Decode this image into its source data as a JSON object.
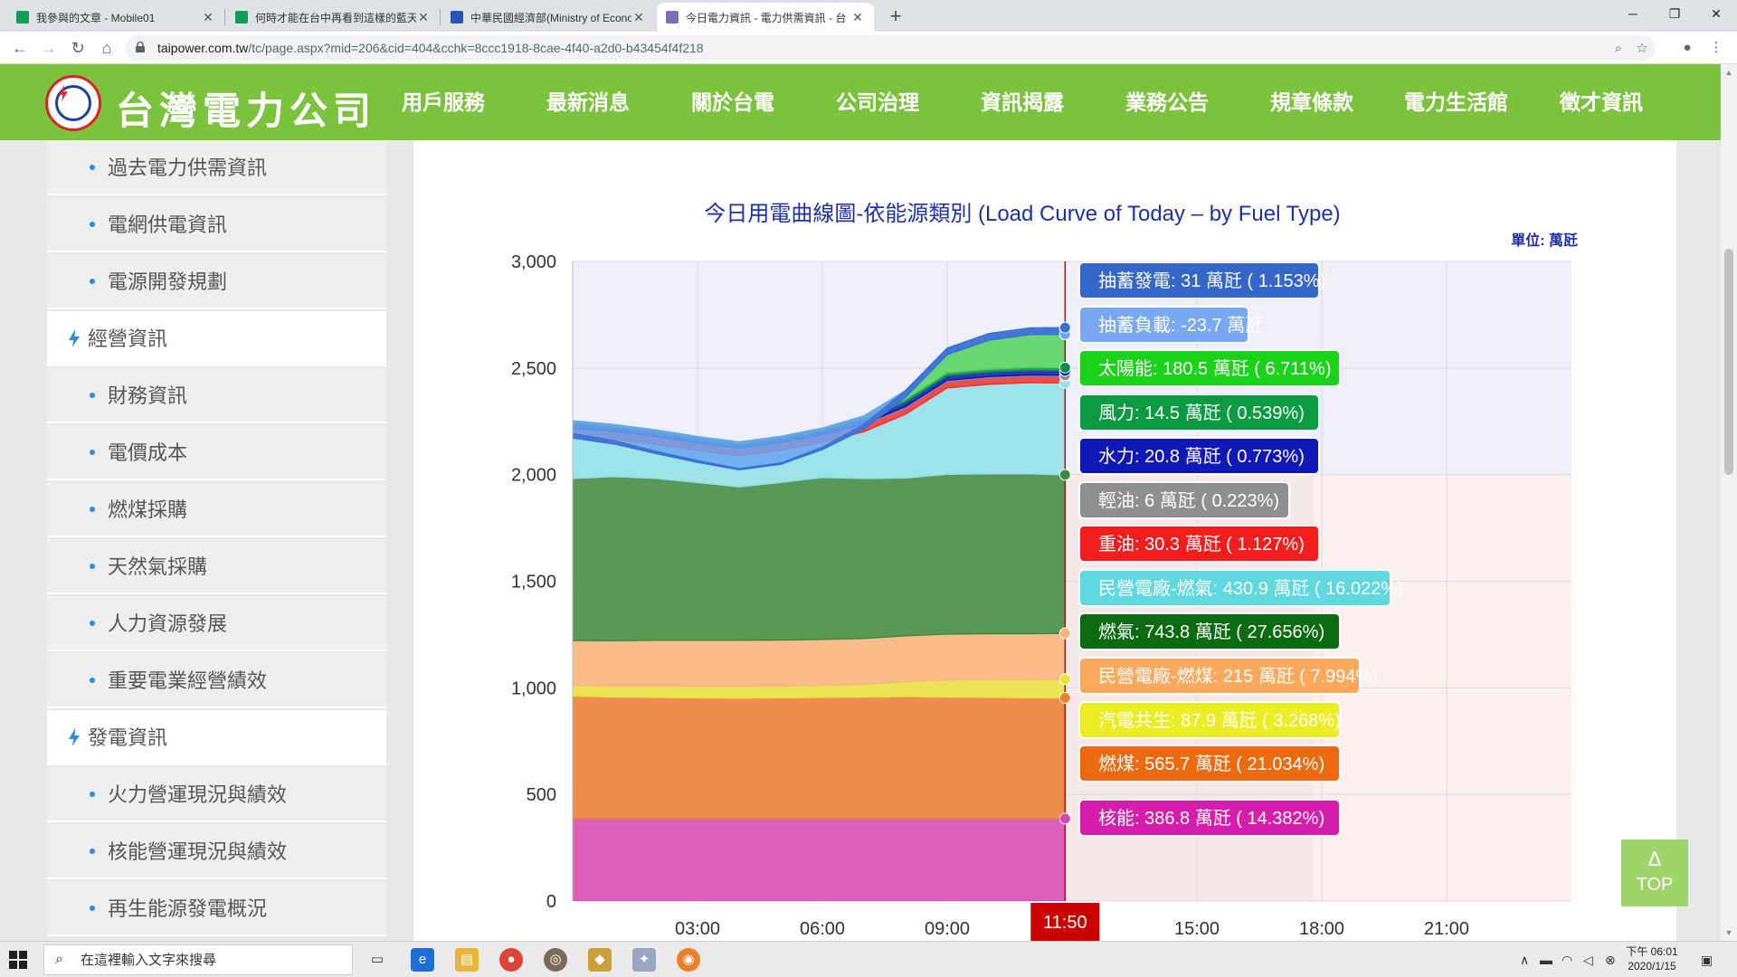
{
  "browser": {
    "tabs": [
      {
        "title": "我參與的文章 - Mobile01",
        "fav_color": "#0f9d58",
        "active": false
      },
      {
        "title": "何時才能在台中再看到這樣的藍天",
        "fav_color": "#0f9d58",
        "active": false
      },
      {
        "title": "中華民國經濟部(Ministry of Economic",
        "fav_color": "#2b52b6",
        "active": false
      },
      {
        "title": "今日電力資訊 - 電力供需資訊 - 台",
        "fav_color": "#7a6fb7",
        "active": true
      }
    ],
    "new_tab": "+",
    "url_host": "taipower.com.tw",
    "url_path": "/tc/page.aspx?mid=206&cid=404&cchk=8ccc1918-8cae-4f40-a2d0-b43454f4f218"
  },
  "site": {
    "brand": "台灣電力公司",
    "nav": [
      "用戶服務",
      "最新消息",
      "關於台電",
      "公司治理",
      "資訊揭露",
      "業務公告",
      "規章條款",
      "電力生活館",
      "徵才資訊"
    ],
    "active_nav": "資訊揭露"
  },
  "sidebar": {
    "items": [
      {
        "label": "過去電力供需資訊",
        "group": false
      },
      {
        "label": "電網供電資訊",
        "group": false
      },
      {
        "label": "電源開發規劃",
        "group": false
      },
      {
        "label": "經營資訊",
        "group": true
      },
      {
        "label": "財務資訊",
        "group": false
      },
      {
        "label": "電價成本",
        "group": false
      },
      {
        "label": "燃煤採購",
        "group": false
      },
      {
        "label": "天然氣採購",
        "group": false
      },
      {
        "label": "人力資源發展",
        "group": false
      },
      {
        "label": "重要電業經營績效",
        "group": false
      },
      {
        "label": "發電資訊",
        "group": true
      },
      {
        "label": "火力營運現況與績效",
        "group": false
      },
      {
        "label": "核能營運現況與績效",
        "group": false
      },
      {
        "label": "再生能源發電概況",
        "group": false
      }
    ]
  },
  "chart_data": {
    "type": "area",
    "title": "今日用電曲線圖-依能源類別 (Load Curve of Today – by Fuel Type)",
    "unit_label": "單位: 萬瓩",
    "ylim": [
      0,
      3000
    ],
    "yticks": [
      0,
      500,
      1000,
      1500,
      2000,
      2500,
      3000
    ],
    "ytick_labels": [
      "0",
      "500",
      "1,000",
      "1,500",
      "2,000",
      "2,500",
      "3,000"
    ],
    "xticks": [
      3,
      6,
      9,
      15,
      18,
      21
    ],
    "xtick_labels": [
      "03:00",
      "06:00",
      "09:00",
      "15:00",
      "18:00",
      "21:00"
    ],
    "xlim": [
      0,
      24
    ],
    "cursor_time": 11.833,
    "cursor_label": "11:50",
    "grid": true,
    "x": [
      0.0,
      1.0,
      2.0,
      3.0,
      4.0,
      5.0,
      6.0,
      7.0,
      8.0,
      9.0,
      10.0,
      11.0,
      11.833
    ],
    "series": [
      {
        "name": "核能",
        "color": "#d946b0",
        "values": [
          387,
          387,
          387,
          387,
          387,
          387,
          387,
          387,
          387,
          387,
          387,
          387,
          386.8
        ]
      },
      {
        "name": "燃煤",
        "color": "#ed7d31",
        "values": [
          575,
          570,
          568,
          566,
          565,
          566,
          568,
          570,
          572,
          570,
          568,
          566,
          565.7
        ]
      },
      {
        "name": "汽電共生",
        "color": "#e8e23c",
        "values": [
          50,
          52,
          54,
          55,
          56,
          56,
          57,
          60,
          70,
          80,
          84,
          86,
          87.9
        ]
      },
      {
        "name": "民營電廠-燃煤",
        "color": "#fbb47a",
        "values": [
          210,
          212,
          214,
          215,
          215,
          215,
          215,
          215,
          215,
          215,
          215,
          215,
          215
        ]
      },
      {
        "name": "燃氣",
        "color": "#3d8a3d",
        "values": [
          760,
          770,
          760,
          740,
          720,
          740,
          760,
          750,
          740,
          750,
          750,
          750,
          743.8
        ]
      },
      {
        "name": "民營電廠-燃氣",
        "color": "#8fe0e6",
        "values": [
          200,
          175,
          160,
          150,
          145,
          150,
          165,
          220,
          300,
          405,
          420,
          428,
          430.9
        ]
      },
      {
        "name": "重油",
        "color": "#f03030",
        "values": [
          30,
          30,
          30,
          30,
          30,
          30,
          30,
          30,
          30,
          30,
          30,
          30,
          30.3
        ]
      },
      {
        "name": "輕油",
        "color": "#8c8c8c",
        "values": [
          6,
          6,
          6,
          6,
          6,
          6,
          6,
          6,
          6,
          6,
          6,
          6,
          6
        ]
      },
      {
        "name": "水力",
        "color": "#0d14b8",
        "values": [
          20,
          18,
          16,
          15,
          15,
          15,
          16,
          18,
          20,
          21,
          21,
          21,
          20.8
        ]
      },
      {
        "name": "風力",
        "color": "#0c8f4a",
        "values": [
          14,
          14,
          14,
          14,
          14,
          14,
          14,
          14,
          14,
          14,
          14,
          14,
          14.5
        ]
      },
      {
        "name": "太陽能",
        "color": "#4fd45a",
        "values": [
          0,
          0,
          0,
          0,
          0,
          0,
          0,
          5,
          40,
          110,
          160,
          178,
          180.5
        ]
      },
      {
        "name": "抽蓄負載",
        "color": "#6aa6f2",
        "values": [
          -80,
          -90,
          -110,
          -120,
          -130,
          -130,
          -100,
          -60,
          -30,
          -25,
          -24,
          -24,
          -23.7
        ]
      },
      {
        "name": "抽蓄發電",
        "color": "#3b6fd4",
        "values": [
          20,
          15,
          10,
          8,
          5,
          5,
          10,
          20,
          30,
          30,
          31,
          31,
          31
        ]
      }
    ],
    "tooltip": [
      {
        "text": "抽蓄發電: 31 萬瓩 ( 1.153%)",
        "bg": "#3566c9",
        "fg": "#ffffff"
      },
      {
        "text": "抽蓄負載: -23.7 萬瓩",
        "bg": "#79a9f2",
        "fg": "#ffffff"
      },
      {
        "text": "太陽能: 180.5 萬瓩 ( 6.711%)",
        "bg": "#1bd21b",
        "fg": "#ffffff"
      },
      {
        "text": "風力: 14.5 萬瓩 ( 0.539%)",
        "bg": "#0c9b43",
        "fg": "#ffffff"
      },
      {
        "text": "水力: 20.8 萬瓩 ( 0.773%)",
        "bg": "#1118b8",
        "fg": "#ffffff"
      },
      {
        "text": "輕油: 6 萬瓩 ( 0.223%)",
        "bg": "#8f8f8f",
        "fg": "#ffffff"
      },
      {
        "text": "重油: 30.3 萬瓩 ( 1.127%)",
        "bg": "#f21e1e",
        "fg": "#ffffff"
      },
      {
        "text": "民營電廠-燃氣: 430.9 萬瓩 ( 16.022%)",
        "bg": "#5fd8e0",
        "fg": "#ffffff"
      },
      {
        "text": "燃氣: 743.8 萬瓩 ( 27.656%)",
        "bg": "#0a6b10",
        "fg": "#ffffff"
      },
      {
        "text": "民營電廠-燃煤: 215 萬瓩 ( 7.994%)",
        "bg": "#fca95d",
        "fg": "#ffffff"
      },
      {
        "text": "汽電共生: 87.9 萬瓩 ( 3.268%)",
        "bg": "#ecec22",
        "fg": "#ffffff"
      },
      {
        "text": "燃煤: 565.7 萬瓩 ( 21.034%)",
        "bg": "#ee6a10",
        "fg": "#ffffff"
      },
      {
        "text": "核能: 386.8 萬瓩 ( 14.382%)",
        "bg": "#d61eae",
        "fg": "#ffffff"
      }
    ]
  },
  "top_button": {
    "arrow": "Δ",
    "label": "TOP"
  },
  "taskbar": {
    "search_placeholder": "在這裡輸入文字來搜尋",
    "time": "下午 06:01",
    "date": "2020/1/15"
  }
}
